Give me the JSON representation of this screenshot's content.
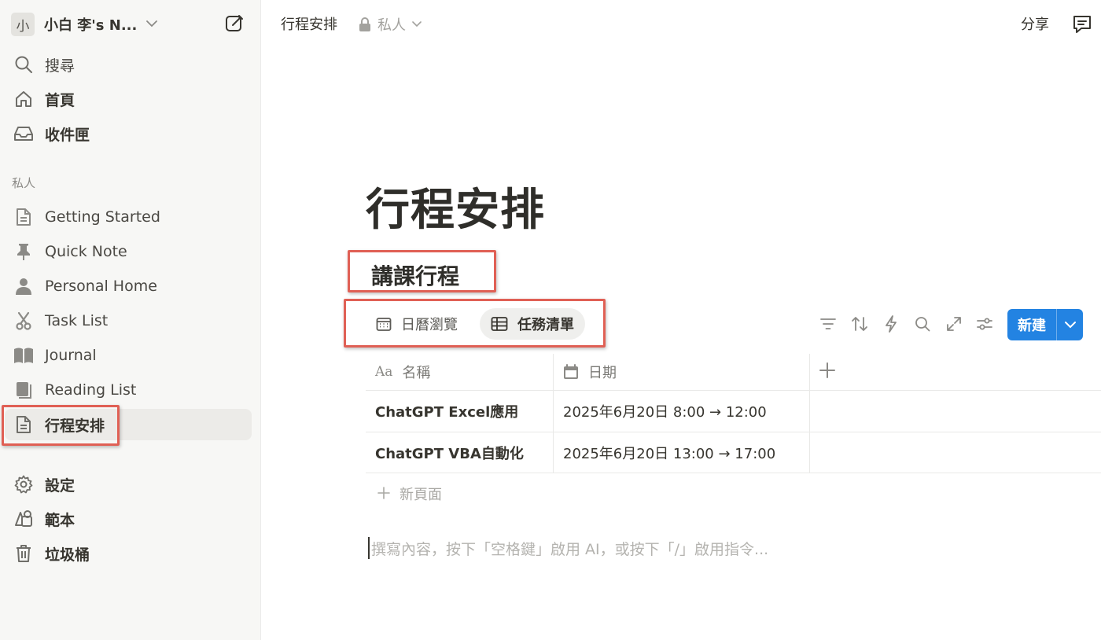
{
  "sidebar": {
    "workspace_avatar": "小",
    "workspace_name": "小白 李's N...",
    "top_items": [
      {
        "label": "搜尋",
        "icon": "search-icon"
      },
      {
        "label": "首頁",
        "icon": "home-icon"
      },
      {
        "label": "收件匣",
        "icon": "inbox-icon"
      }
    ],
    "section_label": "私人",
    "pages": [
      {
        "label": "Getting Started",
        "icon": "page-icon"
      },
      {
        "label": "Quick Note",
        "icon": "pin-icon"
      },
      {
        "label": "Personal Home",
        "icon": "person-icon"
      },
      {
        "label": "Task List",
        "icon": "scissors-icon"
      },
      {
        "label": "Journal",
        "icon": "book-open-icon"
      },
      {
        "label": "Reading List",
        "icon": "books-icon"
      },
      {
        "label": "行程安排",
        "icon": "page-icon",
        "active": true
      }
    ],
    "bottom_items": [
      {
        "label": "設定",
        "icon": "gear-icon"
      },
      {
        "label": "範本",
        "icon": "templates-icon"
      },
      {
        "label": "垃圾桶",
        "icon": "trash-icon"
      }
    ]
  },
  "topbar": {
    "title": "行程安排",
    "privacy": "私人",
    "share": "分享"
  },
  "page": {
    "title": "行程安排",
    "database_title": "講課行程",
    "views": [
      {
        "label": "日曆瀏覽",
        "icon": "calendar-icon"
      },
      {
        "label": "任務清單",
        "icon": "table-icon",
        "active": true
      }
    ],
    "new_button": "新建",
    "columns": [
      {
        "label": "名稱",
        "icon": "Aa"
      },
      {
        "label": "日期",
        "icon": "calendar-icon"
      }
    ],
    "rows": [
      {
        "name": "ChatGPT Excel應用",
        "date": "2025年6月20日 8:00 → 12:00"
      },
      {
        "name": "ChatGPT VBA自動化",
        "date": "2025年6月20日 13:00 → 17:00"
      }
    ],
    "new_page": "新頁面",
    "editor_placeholder": "撰寫內容，按下「空格鍵」啟用 AI，或按下「/」啟用指令..."
  },
  "colors": {
    "accent": "#2383e2",
    "highlight": "#e06055",
    "sidebar_bg": "#f7f7f5"
  }
}
